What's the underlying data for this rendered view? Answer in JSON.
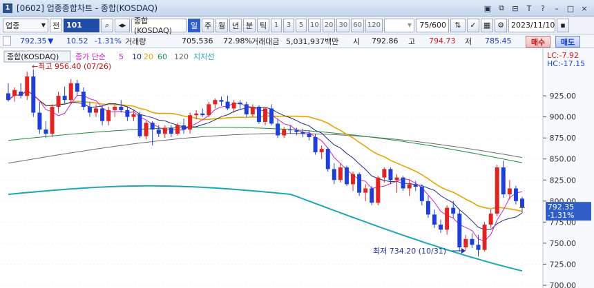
{
  "window": {
    "number": "1",
    "title": "[0602] 업종종합차트 - 종합(KOSDAQ)",
    "controls": [
      "▣",
      "⧉",
      "⊟",
      "T",
      "?",
      "–",
      "□",
      "×"
    ]
  },
  "toolbar": {
    "market_select": "업종",
    "cb_label": "전",
    "code": "101",
    "name": "종합(KOSDAQ)",
    "periods": [
      "일",
      "주",
      "월",
      "년",
      "분",
      "틱"
    ],
    "active_period": "일",
    "intervals": [
      "1",
      "3",
      "5",
      "10",
      "20",
      "30",
      "60",
      "120"
    ],
    "count": "75/600",
    "date": "2023/11/10"
  },
  "quote": {
    "price": "792.35",
    "change_arrow": "▼",
    "change": "10.52",
    "change_pct": "-1.31%",
    "volume_label": "거래량",
    "volume": "705,536",
    "volume_ratio": "72.98%",
    "amount_label": "거래대금",
    "amount": "5,031,937백만",
    "open_label": "시",
    "open": "792.86",
    "high_label": "고",
    "high": "794.73",
    "low_label": "저",
    "low": "785.45",
    "buy": "매수",
    "sell": "매도"
  },
  "chart_labels": {
    "index_name": "종합(KOSDAQ)",
    "ma_title": "종가 단순",
    "ma_periods": [
      "5",
      "10",
      "20",
      "60",
      "120"
    ],
    "support": "지지선",
    "high_annotation": "←최고 956.40 (07/26)",
    "low_annotation": "최저 734.20 (10/31)",
    "lc": "LC:-7.92",
    "hc": "HC:-17.15",
    "price_tag": "792.35",
    "price_tag_pct": "-1.31%"
  },
  "colors": {
    "up": "#e02424",
    "down": "#1f3fd8",
    "ma5": "#d321c8",
    "ma10": "#1c2a80",
    "ma20": "#e8a200",
    "ma60": "#1f8a3a",
    "ma120": "#6b6b6b",
    "support": "#1aa7b3"
  },
  "chart_data": {
    "type": "candlestick",
    "y_ticks": [
      "925.00",
      "900.00",
      "875.00",
      "850.00",
      "825.00",
      "800.00",
      "775.00",
      "750.00",
      "725.00",
      "700.00"
    ],
    "ylim": [
      700,
      975
    ],
    "candles": [
      [
        928,
        940,
        918,
        920
      ],
      [
        925,
        935,
        918,
        932
      ],
      [
        930,
        940,
        922,
        925
      ],
      [
        925,
        954,
        920,
        948
      ],
      [
        948,
        956.4,
        900,
        905
      ],
      [
        905,
        918,
        880,
        885
      ],
      [
        885,
        895,
        875,
        880
      ],
      [
        880,
        915,
        876,
        912
      ],
      [
        912,
        930,
        905,
        925
      ],
      [
        925,
        936,
        916,
        920
      ],
      [
        920,
        945,
        915,
        940
      ],
      [
        940,
        944,
        925,
        930
      ],
      [
        930,
        935,
        908,
        912
      ],
      [
        912,
        918,
        900,
        905
      ],
      [
        905,
        915,
        900,
        910
      ],
      [
        910,
        914,
        890,
        895
      ],
      [
        895,
        912,
        890,
        908
      ],
      [
        908,
        915,
        900,
        912
      ],
      [
        912,
        920,
        905,
        908
      ],
      [
        908,
        912,
        895,
        900
      ],
      [
        900,
        908,
        895,
        903
      ],
      [
        903,
        906,
        875,
        877
      ],
      [
        877,
        895,
        873,
        893
      ],
      [
        893,
        895,
        866,
        885
      ],
      [
        885,
        890,
        876,
        880
      ],
      [
        880,
        890,
        875,
        887
      ],
      [
        887,
        890,
        876,
        880
      ],
      [
        880,
        893,
        878,
        890
      ],
      [
        890,
        898,
        880,
        885
      ],
      [
        885,
        905,
        880,
        902
      ],
      [
        902,
        908,
        897,
        904
      ],
      [
        904,
        910,
        900,
        902
      ],
      [
        902,
        918,
        900,
        915
      ],
      [
        915,
        922,
        910,
        920
      ],
      [
        920,
        924,
        913,
        918
      ],
      [
        918,
        925,
        908,
        910
      ],
      [
        910,
        920,
        905,
        917
      ],
      [
        917,
        920,
        908,
        915
      ],
      [
        915,
        918,
        900,
        903
      ],
      [
        903,
        915,
        900,
        912
      ],
      [
        912,
        914,
        892,
        894
      ],
      [
        894,
        912,
        890,
        910
      ],
      [
        910,
        915,
        890,
        892
      ],
      [
        892,
        898,
        875,
        878
      ],
      [
        878,
        888,
        875,
        885
      ],
      [
        885,
        890,
        880,
        884
      ],
      [
        884,
        887,
        878,
        882
      ],
      [
        882,
        886,
        876,
        880
      ],
      [
        880,
        884,
        872,
        876
      ],
      [
        876,
        880,
        855,
        858
      ],
      [
        858,
        866,
        850,
        862
      ],
      [
        862,
        864,
        835,
        838
      ],
      [
        838,
        845,
        820,
        825
      ],
      [
        825,
        845,
        822,
        840
      ],
      [
        840,
        842,
        818,
        820
      ],
      [
        820,
        835,
        812,
        832
      ],
      [
        832,
        834,
        806,
        810
      ],
      [
        810,
        820,
        800,
        815
      ],
      [
        815,
        818,
        795,
        798
      ],
      [
        798,
        830,
        795,
        828
      ],
      [
        828,
        840,
        822,
        838
      ],
      [
        838,
        840,
        820,
        825
      ],
      [
        825,
        832,
        810,
        828
      ],
      [
        828,
        830,
        812,
        815
      ],
      [
        815,
        826,
        806,
        820
      ],
      [
        820,
        824,
        812,
        817
      ],
      [
        817,
        820,
        795,
        800
      ],
      [
        800,
        806,
        780,
        784
      ],
      [
        784,
        790,
        768,
        772
      ],
      [
        772,
        778,
        762,
        766
      ],
      [
        766,
        795,
        760,
        792
      ],
      [
        792,
        800,
        780,
        785
      ],
      [
        785,
        790,
        740,
        745
      ],
      [
        745,
        760,
        741,
        755
      ],
      [
        755,
        762,
        744,
        748
      ],
      [
        748,
        760,
        734.2,
        742
      ],
      [
        742,
        775,
        740,
        772
      ],
      [
        772,
        790,
        768,
        785
      ],
      [
        785,
        843,
        782,
        840
      ],
      [
        840,
        848,
        804,
        808
      ],
      [
        808,
        825,
        802,
        815
      ],
      [
        815,
        818,
        796,
        800
      ],
      [
        802.87,
        805,
        786,
        792.35
      ]
    ]
  }
}
